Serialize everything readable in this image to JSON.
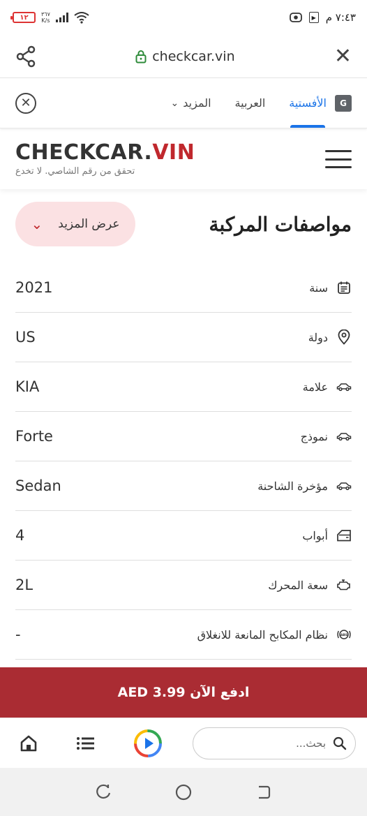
{
  "status_bar": {
    "battery": "١٢",
    "net_speed_value": "٣٦٧",
    "net_speed_unit": "K/s",
    "time": "٧:٤٣ م"
  },
  "browser": {
    "url": "checkcar.vin"
  },
  "translate_bar": {
    "more_label": "المزيد",
    "target_language": "العربية",
    "source_language": "الأفستية"
  },
  "site": {
    "logo_dark": "CHECKCAR.",
    "logo_red": "VIN",
    "tagline": "تحقق من رقم الشاصي. لا تخدع"
  },
  "specs": {
    "title": "مواصفات المركبة",
    "show_more": "عرض المزيد",
    "rows": [
      {
        "label": "سنة",
        "value": "2021",
        "icon": "calendar-icon"
      },
      {
        "label": "دولة",
        "value": "US",
        "icon": "location-pin-icon"
      },
      {
        "label": "علامة",
        "value": "KIA",
        "icon": "car-icon"
      },
      {
        "label": "نموذج",
        "value": "Forte",
        "icon": "car-icon"
      },
      {
        "label": "مؤخرة الشاحنة",
        "value": "Sedan",
        "icon": "car-icon"
      },
      {
        "label": "أبواب",
        "value": "4",
        "icon": "car-door-icon"
      },
      {
        "label": "سعة المحرك",
        "value": "2L",
        "icon": "engine-icon"
      },
      {
        "label": "نظام المكابح المانعة للانغلاق",
        "value": "-",
        "icon": "abs-icon"
      }
    ]
  },
  "pay_button": {
    "label": "AED ادفع الآن 3.99"
  },
  "bottom_bar": {
    "search_placeholder": "بحث..."
  },
  "colors": {
    "brand_red": "#c0282d",
    "pay_banner": "#aa2c33",
    "link_blue": "#1a73e8",
    "pill_pink": "#fbe1e3"
  }
}
